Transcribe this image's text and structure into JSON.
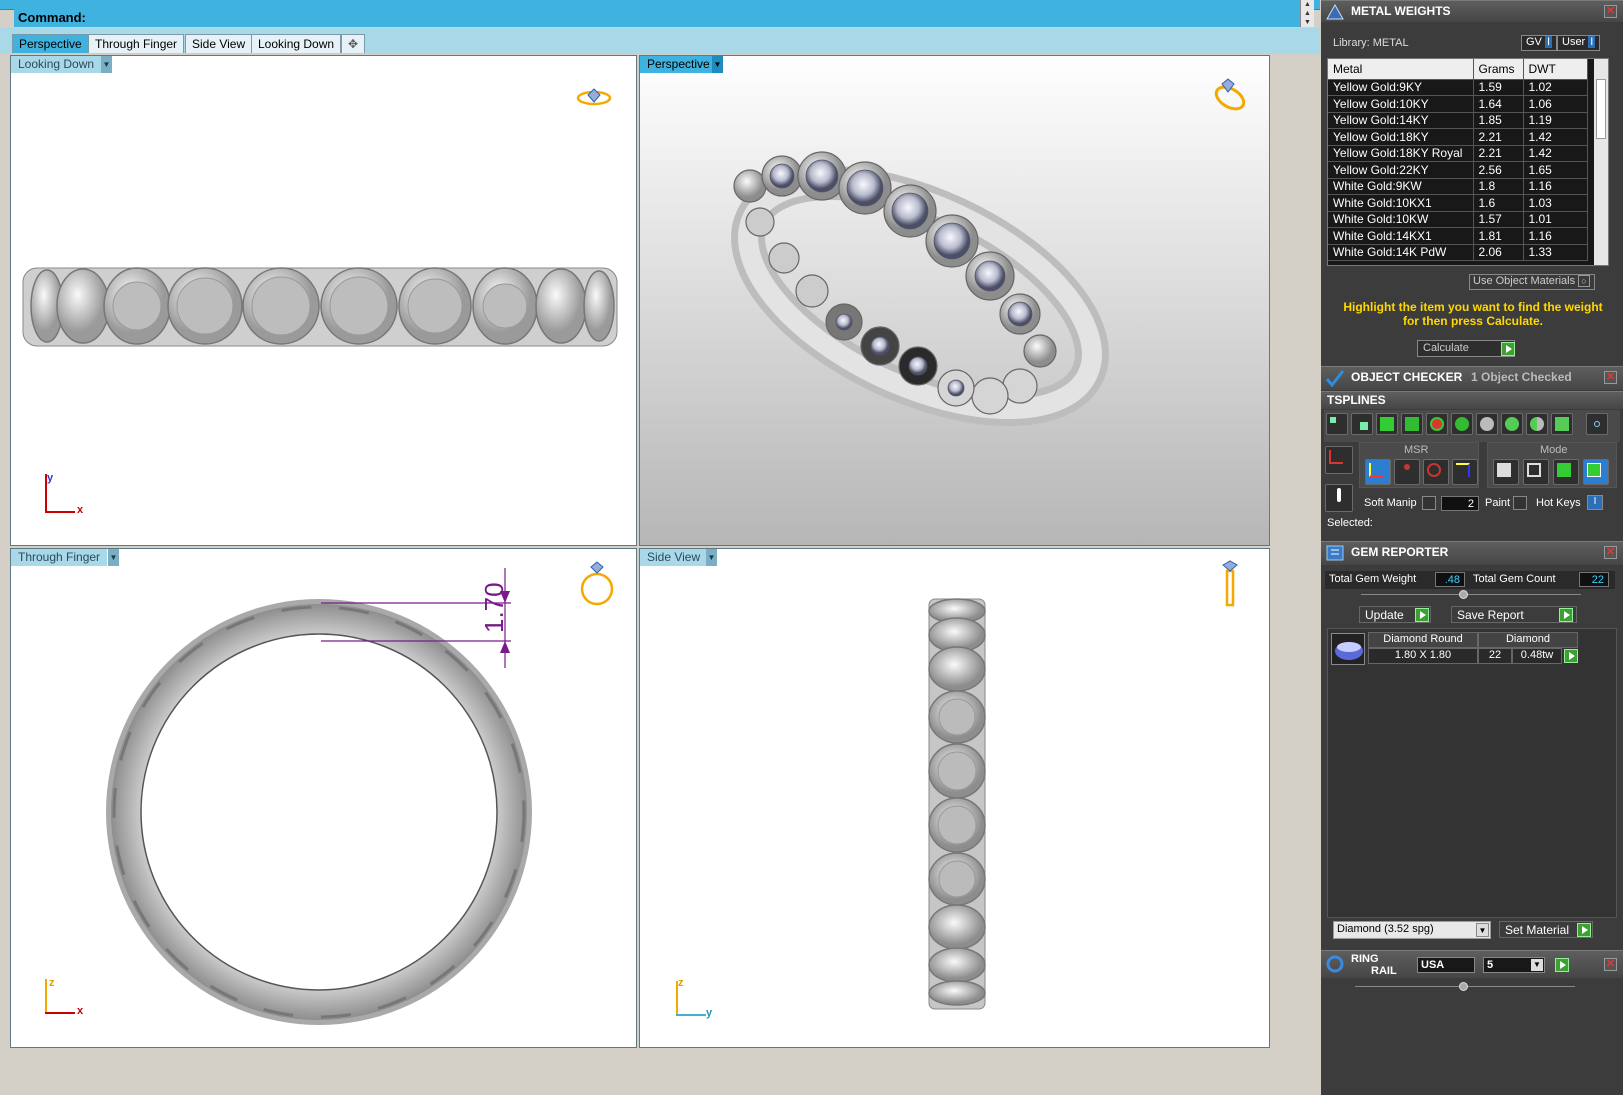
{
  "command_bar": {
    "label": "Command:"
  },
  "tabs": [
    "Perspective",
    "Through Finger",
    "Side View",
    "Looking Down"
  ],
  "viewports": {
    "top_left": {
      "label": "Looking Down",
      "axes": [
        "y",
        "x"
      ]
    },
    "top_right": {
      "label": "Perspective"
    },
    "bottom_left": {
      "label": "Through Finger",
      "axes": [
        "z",
        "x"
      ],
      "dimension": "1.70"
    },
    "bottom_right": {
      "label": "Side View",
      "axes": [
        "z",
        "y"
      ]
    }
  },
  "metal_weights": {
    "title": "METAL WEIGHTS",
    "library": "Library: METAL",
    "toggles": [
      "GV",
      "User"
    ],
    "columns": [
      "Metal",
      "Grams",
      "DWT"
    ],
    "rows": [
      [
        "Yellow Gold:9KY",
        "1.59",
        "1.02"
      ],
      [
        "Yellow Gold:10KY",
        "1.64",
        "1.06"
      ],
      [
        "Yellow Gold:14KY",
        "1.85",
        "1.19"
      ],
      [
        "Yellow Gold:18KY",
        "2.21",
        "1.42"
      ],
      [
        "Yellow Gold:18KY Royal",
        "2.21",
        "1.42"
      ],
      [
        "Yellow Gold:22KY",
        "2.56",
        "1.65"
      ],
      [
        "White Gold:9KW",
        "1.8",
        "1.16"
      ],
      [
        "White Gold:10KX1",
        "1.6",
        "1.03"
      ],
      [
        "White Gold:10KW",
        "1.57",
        "1.01"
      ],
      [
        "White Gold:14KX1",
        "1.81",
        "1.16"
      ],
      [
        "White Gold:14K PdW",
        "2.06",
        "1.33"
      ]
    ],
    "use_object_materials": "Use Object Materials",
    "hint": "Highlight the item you want to find the weight for then press Calculate.",
    "calculate": "Calculate"
  },
  "object_checker": {
    "title": "OBJECT CHECKER",
    "status": "1 Object Checked"
  },
  "tsplines": {
    "title": "TSPLINES",
    "msr_label": "MSR",
    "mode_label": "Mode",
    "soft_manip": "Soft Manip",
    "soft_value": "2",
    "paint": "Paint",
    "hot_keys": "Hot Keys",
    "selected": "Selected:"
  },
  "gem_reporter": {
    "title": "GEM REPORTER",
    "total_weight_label": "Total Gem Weight",
    "total_weight": ".48",
    "total_count_label": "Total Gem Count",
    "total_count": "22",
    "update": "Update",
    "save_report": "Save Report",
    "gem_shape": "Diamond Round",
    "gem_size": "1.80 X 1.80",
    "gem_material": "Diamond",
    "gem_count": "22",
    "gem_weight": "0.48tw",
    "material_select": "Diamond     (3.52 spg)",
    "set_material": "Set Material"
  },
  "ring_rail": {
    "title_line1": "RING",
    "title_line2": "RAIL",
    "region": "USA",
    "size": "5"
  },
  "colors": {
    "accent": "#3fb2e0",
    "panel": "#3c3c3c",
    "hint": "#ffd800",
    "gem_value": "#3ed0ff"
  }
}
